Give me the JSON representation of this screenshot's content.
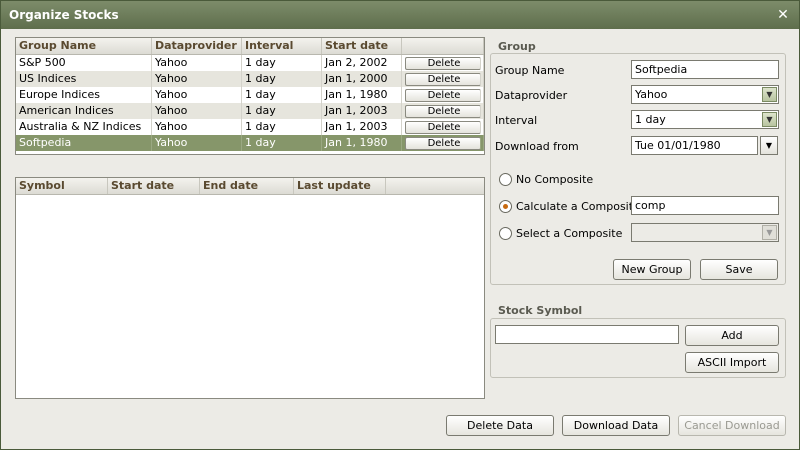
{
  "window": {
    "title": "Organize Stocks"
  },
  "groups_table": {
    "headers": [
      "Group Name",
      "Dataprovider",
      "Interval",
      "Start date"
    ],
    "delete_label": "Delete",
    "rows": [
      [
        "S&P 500",
        "Yahoo",
        "1 day",
        "Jan 2, 2002"
      ],
      [
        "US Indices",
        "Yahoo",
        "1 day",
        "Jan 1, 2000"
      ],
      [
        "Europe Indices",
        "Yahoo",
        "1 day",
        "Jan 1, 1980"
      ],
      [
        "American Indices",
        "Yahoo",
        "1 day",
        "Jan 1, 2003"
      ],
      [
        "Australia & NZ Indices",
        "Yahoo",
        "1 day",
        "Jan 1, 2003"
      ],
      [
        "Softpedia",
        "Yahoo",
        "1 day",
        "Jan 1, 1980"
      ]
    ],
    "selected_index": 5
  },
  "symbols_table": {
    "headers": [
      "Symbol",
      "Start date",
      "End date",
      "Last update"
    ]
  },
  "group_panel": {
    "title": "Group",
    "group_name_label": "Group Name",
    "group_name_value": "Softpedia",
    "dataprovider_label": "Dataprovider",
    "dataprovider_value": "Yahoo",
    "interval_label": "Interval",
    "interval_value": "1 day",
    "download_from_label": "Download from",
    "download_from_value": "Tue 01/01/1980",
    "no_composite_label": "No Composite",
    "calc_composite_label": "Calculate a Composite",
    "calc_composite_value": "comp",
    "select_composite_label": "Select a Composite",
    "new_group_label": "New Group",
    "save_label": "Save"
  },
  "stock_symbol_panel": {
    "title": "Stock Symbol",
    "add_label": "Add",
    "ascii_import_label": "ASCII Import"
  },
  "footer": {
    "delete_data_label": "Delete Data",
    "download_data_label": "Download Data",
    "cancel_download_label": "Cancel Download"
  }
}
